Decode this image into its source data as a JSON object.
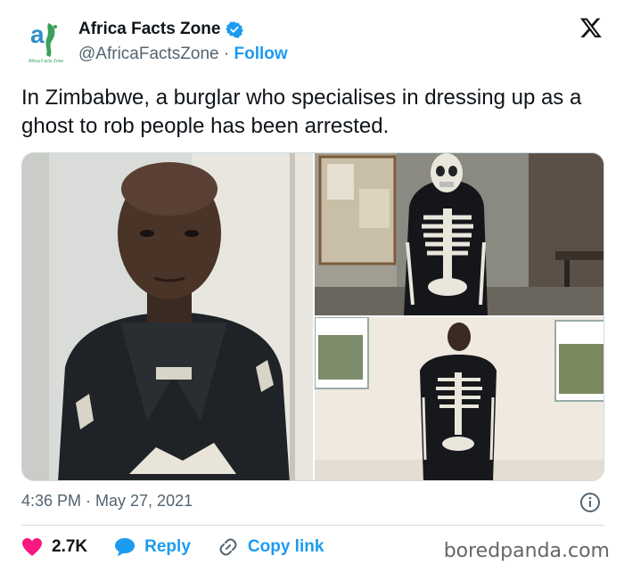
{
  "account": {
    "display_name": "Africa Facts Zone",
    "handle": "@AfricaFactsZone",
    "separator": " · ",
    "follow_label": "Follow",
    "logo_caption": "Africa Facts Zone",
    "verified": true
  },
  "tweet": {
    "text": "In Zimbabwe, a burglar who specialises in dressing up as a ghost to rob people has been arrested.",
    "timestamp": "4:36 PM · May 27, 2021"
  },
  "media": {
    "count": 3,
    "images": [
      "photo-man-portrait",
      "photo-skeleton-costume-mask",
      "photo-skeleton-costume-full"
    ]
  },
  "actions": {
    "likes": "2.7K",
    "reply_label": "Reply",
    "copy_link_label": "Copy link"
  },
  "watermark": "boredpanda.com",
  "colors": {
    "accent": "#1d9bf0",
    "heart": "#f91880",
    "text": "#0f1419",
    "muted": "#536471"
  },
  "icons": [
    "africa-logo-icon",
    "verified-badge-icon",
    "x-logo-icon",
    "info-icon",
    "heart-icon",
    "reply-icon",
    "link-icon"
  ]
}
